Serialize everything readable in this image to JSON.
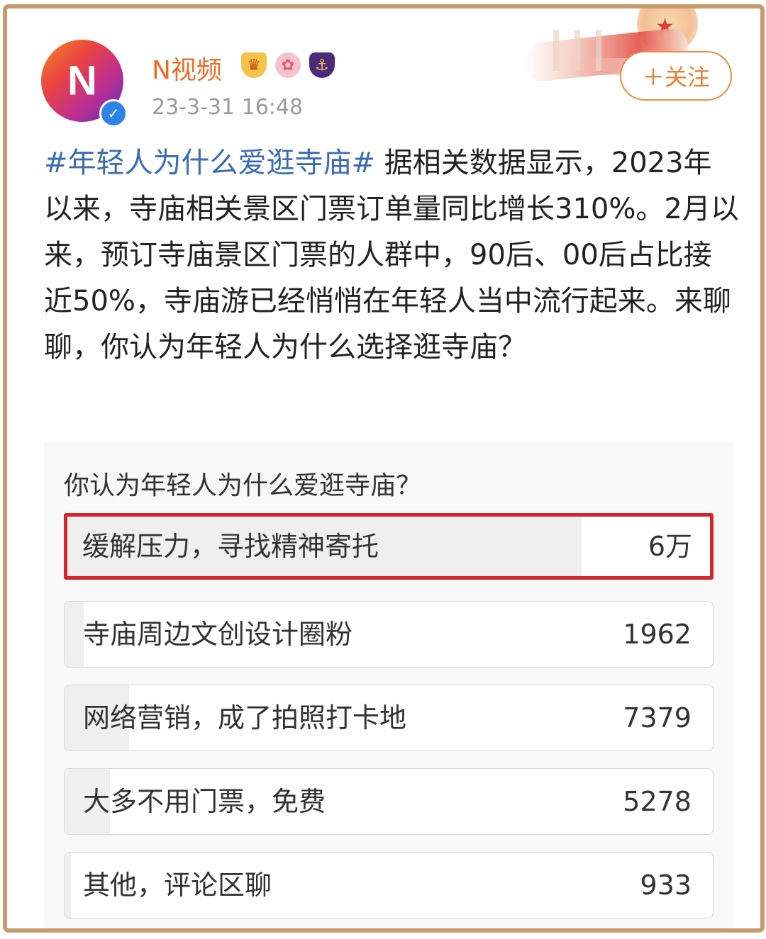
{
  "header": {
    "username": "N视频",
    "timestamp": "23-3-31 16:48",
    "follow_label": "＋关注",
    "avatar_glyph": "N",
    "badges": [
      "medal-badge-icon",
      "sakura-badge-icon",
      "shield-badge-icon"
    ]
  },
  "post": {
    "hashtag": "#年轻人为什么爱逛寺庙#",
    "body": " 据相关数据显示，2023年以来，寺庙相关景区门票订单量同比增长310%。2月以来，预订寺庙景区门票的人群中，90后、00后占比接近50%，寺庙游已经悄悄在年轻人当中流行起来。来聊聊，你认为年轻人为什么选择逛寺庙？"
  },
  "poll": {
    "question": "你认为年轻人为什么爱逛寺庙？",
    "options": [
      {
        "label": "缓解压力，寻找精神寄托",
        "count": "6万",
        "fraction": 0.8,
        "highlighted": true
      },
      {
        "label": "寺庙周边文创设计圈粉",
        "count": "1962",
        "fraction": 0.03
      },
      {
        "label": "网络营销，成了拍照打卡地",
        "count": "7379",
        "fraction": 0.1
      },
      {
        "label": "大多不用门票，免费",
        "count": "5278",
        "fraction": 0.07
      },
      {
        "label": "其他，评论区聊",
        "count": "933",
        "fraction": 0.01
      }
    ]
  },
  "colors": {
    "username": "#f26b22",
    "hashtag": "#3c6bb5",
    "highlight_border": "#d3262c",
    "frame_border": "#c69b6d",
    "follow_border": "#f08a3e"
  }
}
